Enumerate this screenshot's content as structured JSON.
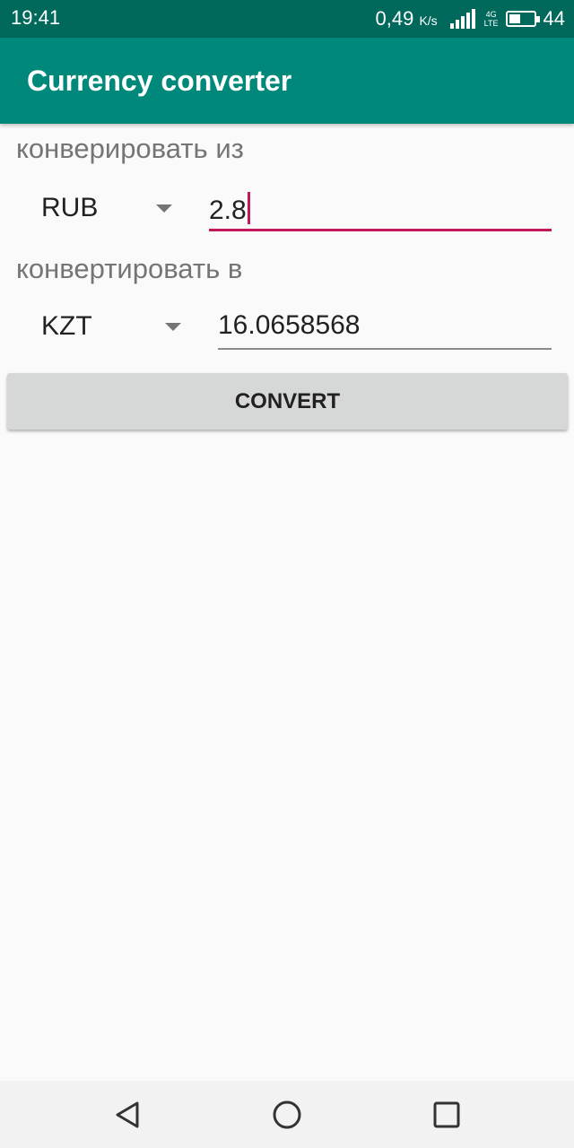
{
  "status_bar": {
    "time": "19:41",
    "speed": "0,49",
    "speed_unit": "K/s",
    "network": "4G",
    "network_sub": "LTE",
    "battery": "44"
  },
  "app_bar": {
    "title": "Currency converter"
  },
  "from": {
    "label": "конверировать из",
    "currency": "RUB",
    "amount": "2.8"
  },
  "to": {
    "label": "конвертировать в",
    "currency": "KZT",
    "amount": "16.0658568"
  },
  "convert_button": {
    "label": "CONVERT"
  },
  "nav_bar": {
    "icons": [
      "back-icon",
      "home-icon",
      "recents-icon"
    ]
  },
  "colors": {
    "app_bar": "#00897b",
    "status_bar": "#00695c",
    "accent": "#c2185b",
    "button": "#d6d7d7",
    "background": "#fafafa"
  }
}
